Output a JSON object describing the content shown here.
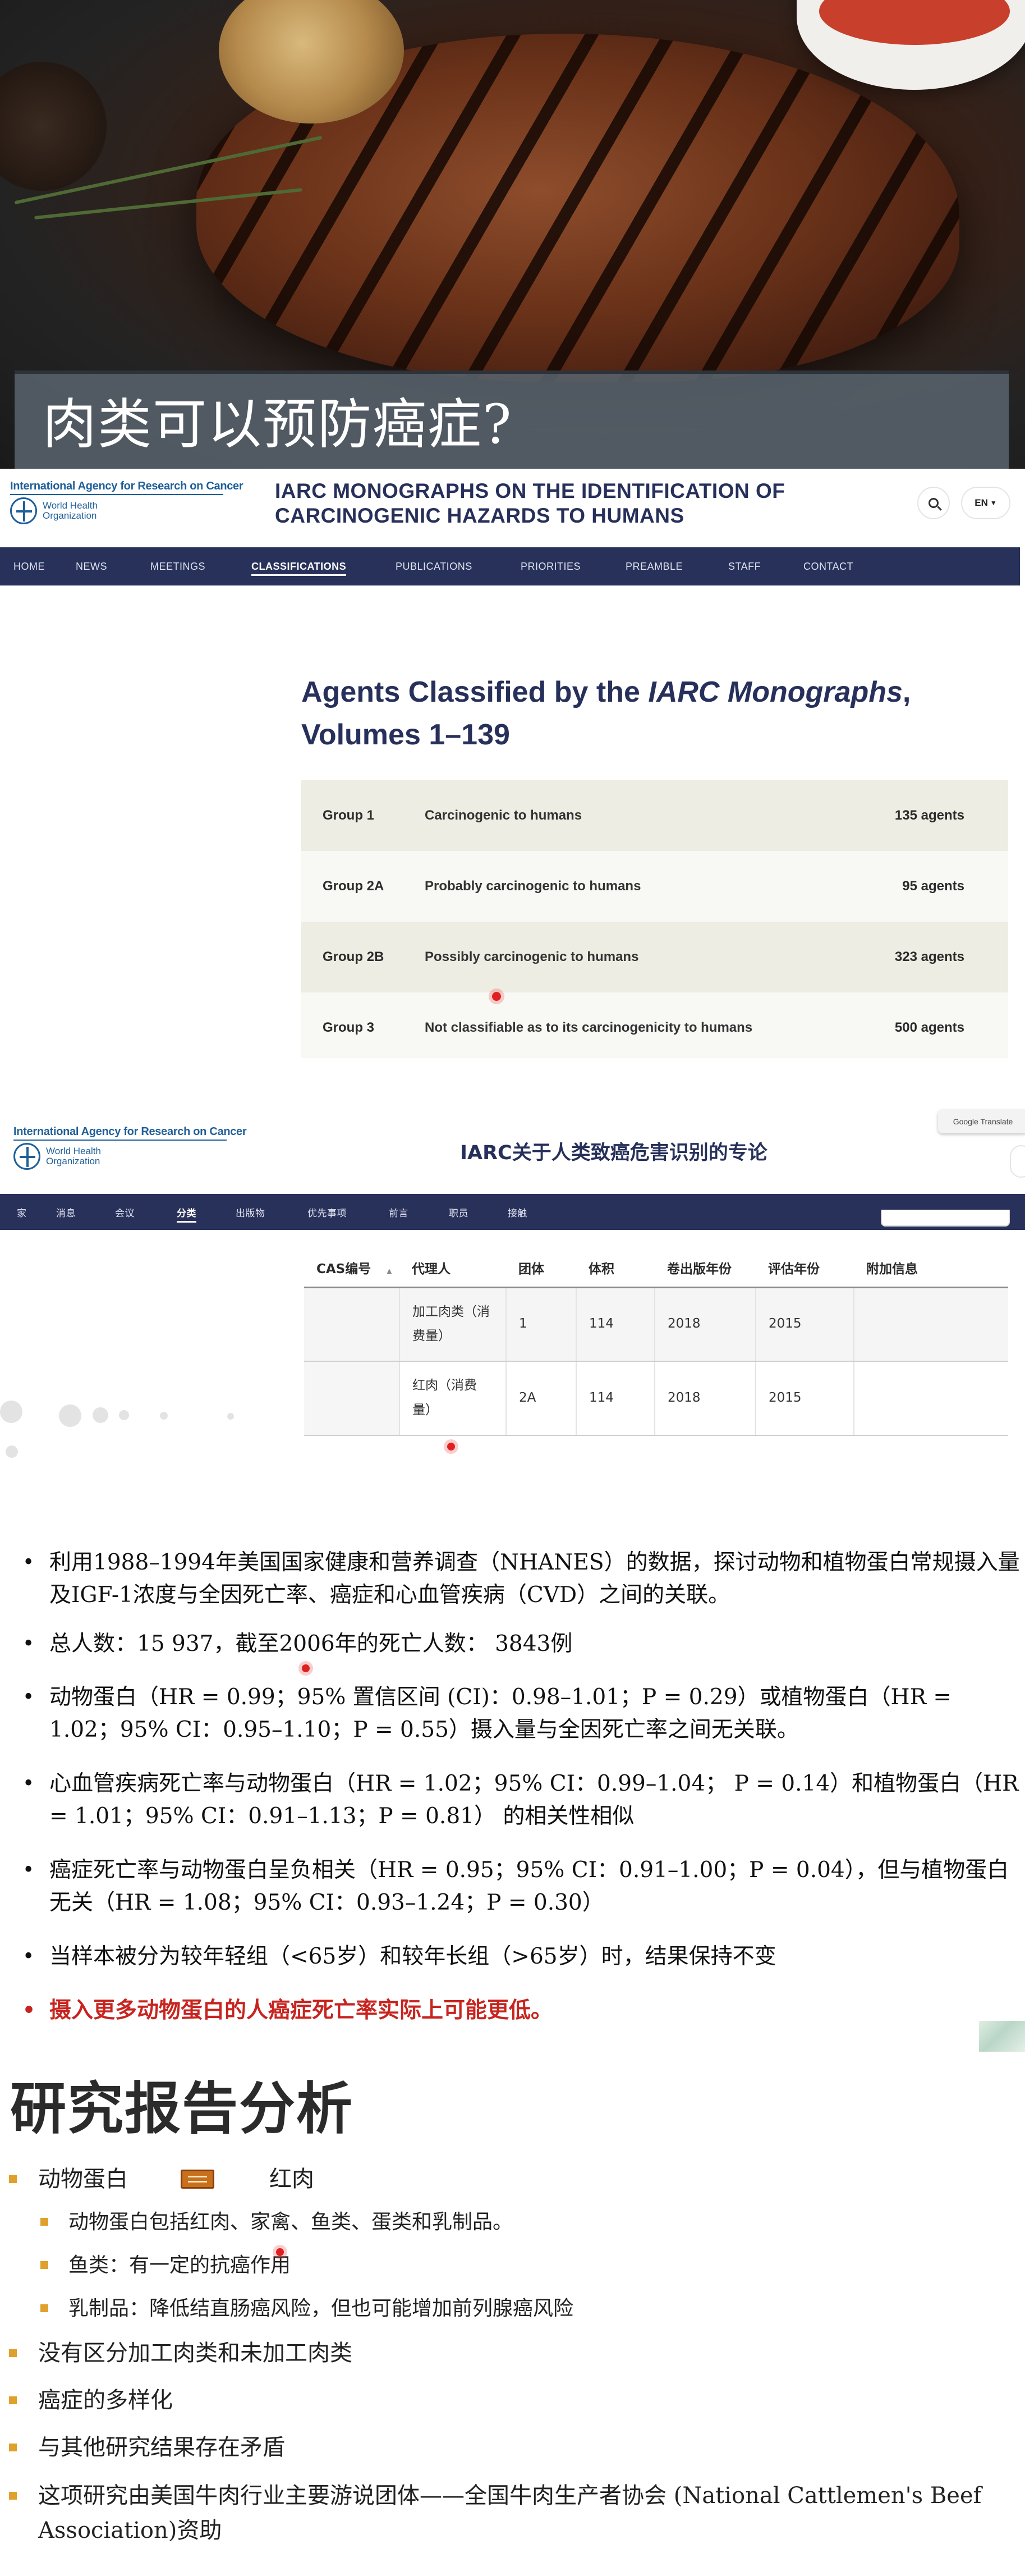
{
  "hero": {
    "title": "肉类可以预防癌症?"
  },
  "iarc_en": {
    "logo": {
      "agency": "International Agency for Research on Cancer",
      "who": "World Health Organization"
    },
    "masthead_line1": "IARC MONOGRAPHS ON THE IDENTIFICATION OF",
    "masthead_line2": "CARCINOGENIC HAZARDS TO HUMANS",
    "lang": "EN",
    "nav": [
      "HOME",
      "NEWS",
      "MEETINGS",
      "CLASSIFICATIONS",
      "PUBLICATIONS",
      "PRIORITIES",
      "PREAMBLE",
      "STAFF",
      "CONTACT"
    ],
    "nav_active": "CLASSIFICATIONS",
    "heading_a": "Agents Classified by the ",
    "heading_b": "IARC Monographs",
    "heading_c": ",",
    "heading_line2": "Volumes 1–139",
    "groups": [
      {
        "group": "Group 1",
        "desc": "Carcinogenic to humans",
        "count": "135 agents"
      },
      {
        "group": "Group 2A",
        "desc": "Probably carcinogenic to humans",
        "count": "95 agents"
      },
      {
        "group": "Group 2B",
        "desc": "Possibly carcinogenic to humans",
        "count": "323 agents"
      },
      {
        "group": "Group 3",
        "desc": "Not classifiable as to its carcinogenicity to humans",
        "count": "500 agents"
      }
    ]
  },
  "iarc_zh": {
    "masthead": "IARC关于人类致癌危害识别的专论",
    "google_translate": "Google Translate",
    "nav": [
      "家",
      "消息",
      "会议",
      "分类",
      "出版物",
      "优先事项",
      "前言",
      "职员",
      "接触"
    ],
    "nav_active": "分类",
    "headers": [
      "CAS编号",
      "代理人",
      "团体",
      "体积",
      "卷出版年份",
      "评估年份",
      "附加信息"
    ],
    "sort_indicator": "▲",
    "rows": [
      {
        "cas": "",
        "agent_l1": "加工肉类（消",
        "agent_l2": "费量）",
        "group": "1",
        "volume": "114",
        "pub_year": "2018",
        "eval_year": "2015",
        "info": ""
      },
      {
        "cas": "",
        "agent_l1": "红肉（消费",
        "agent_l2": "量）",
        "group": "2A",
        "volume": "114",
        "pub_year": "2018",
        "eval_year": "2015",
        "info": ""
      }
    ]
  },
  "study": {
    "bullets": [
      "利用1988–1994年美国国家健康和营养调查（NHANES）的数据，探讨动物和植物蛋白常规摄入量及IGF-1浓度与全因死亡率、癌症和心血管疾病（CVD）之间的关联。",
      "总人数：15 937，截至2006年的死亡人数： 3843例",
      "动物蛋白（HR = 0.99；95% 置信区间 (CI)：0.98–1.01；P = 0.29）或植物蛋白（HR = 1.02；95% CI：0.95–1.10；P = 0.55）摄入量与全因死亡率之间无关联。",
      "心血管疾病死亡率与动物蛋白（HR = 1.02；95% CI：0.99–1.04； P = 0.14）和植物蛋白（HR = 1.01；95% CI：0.91–1.13；P = 0.81） 的相关性相似",
      "癌症死亡率与动物蛋白呈负相关（HR = 0.95；95% CI：0.91–1.00；P = 0.04），但与植物蛋白无关（HR = 1.08；95% CI：0.93–1.24；P = 0.30）",
      "当样本被分为较年轻组（<65岁）和较年长组（>65岁）时，结果保持不变"
    ],
    "highlight": "摄入更多动物蛋白的人癌症死亡率实际上可能更低。",
    "bullet_mark": "•"
  },
  "analysis": {
    "heading": "研究报告分析",
    "item1_left": "动物蛋白",
    "item1_right": "红肉",
    "subs": [
      "动物蛋白包括红肉、家禽、鱼类、蛋类和乳制品。",
      "鱼类：有一定的抗癌作用",
      "乳制品：降低结直肠癌风险，但也可能增加前列腺癌风险"
    ],
    "items": [
      "没有区分加工肉类和未加工肉类",
      "癌症的多样化",
      "与其他研究结果存在矛盾",
      "这项研究由美国牛肉行业主要游说团体——全国牛肉生产者协会 (National Cattlemen's Beef Association)资助"
    ],
    "arrow_icon": "double-arrow-icon"
  }
}
